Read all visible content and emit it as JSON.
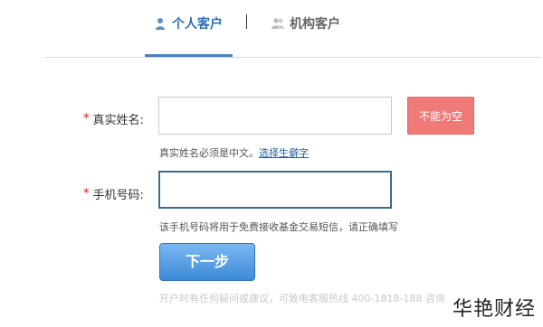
{
  "tabs": {
    "personal_label": "个人客户",
    "org_label": "机构客户",
    "separator": "|"
  },
  "form": {
    "name_label": "真实姓名:",
    "required_mark": "*",
    "name_value": "",
    "name_error": "不能为空",
    "name_hint": "真实姓名必须是中文。",
    "name_hint_link": "选择生僻字",
    "phone_label": "手机号码:",
    "phone_value": "",
    "phone_hint": "该手机号码将用于免费接收基金交易短信，请正确填写",
    "next_button": "下一步"
  },
  "footer": {
    "note": "开户时有任何疑问或建议，可致电客服热线 400-1818-188 咨询"
  },
  "watermark": "华艳财经",
  "colors": {
    "accent_blue": "#2a6fb8",
    "error_badge": "#ef7a78",
    "required_star": "#d61518",
    "button_gradient_top": "#7bb8f2",
    "button_gradient_bottom": "#3d8ad6"
  },
  "icons": {
    "personal_tab": "person-icon",
    "org_tab": "group-icon"
  }
}
